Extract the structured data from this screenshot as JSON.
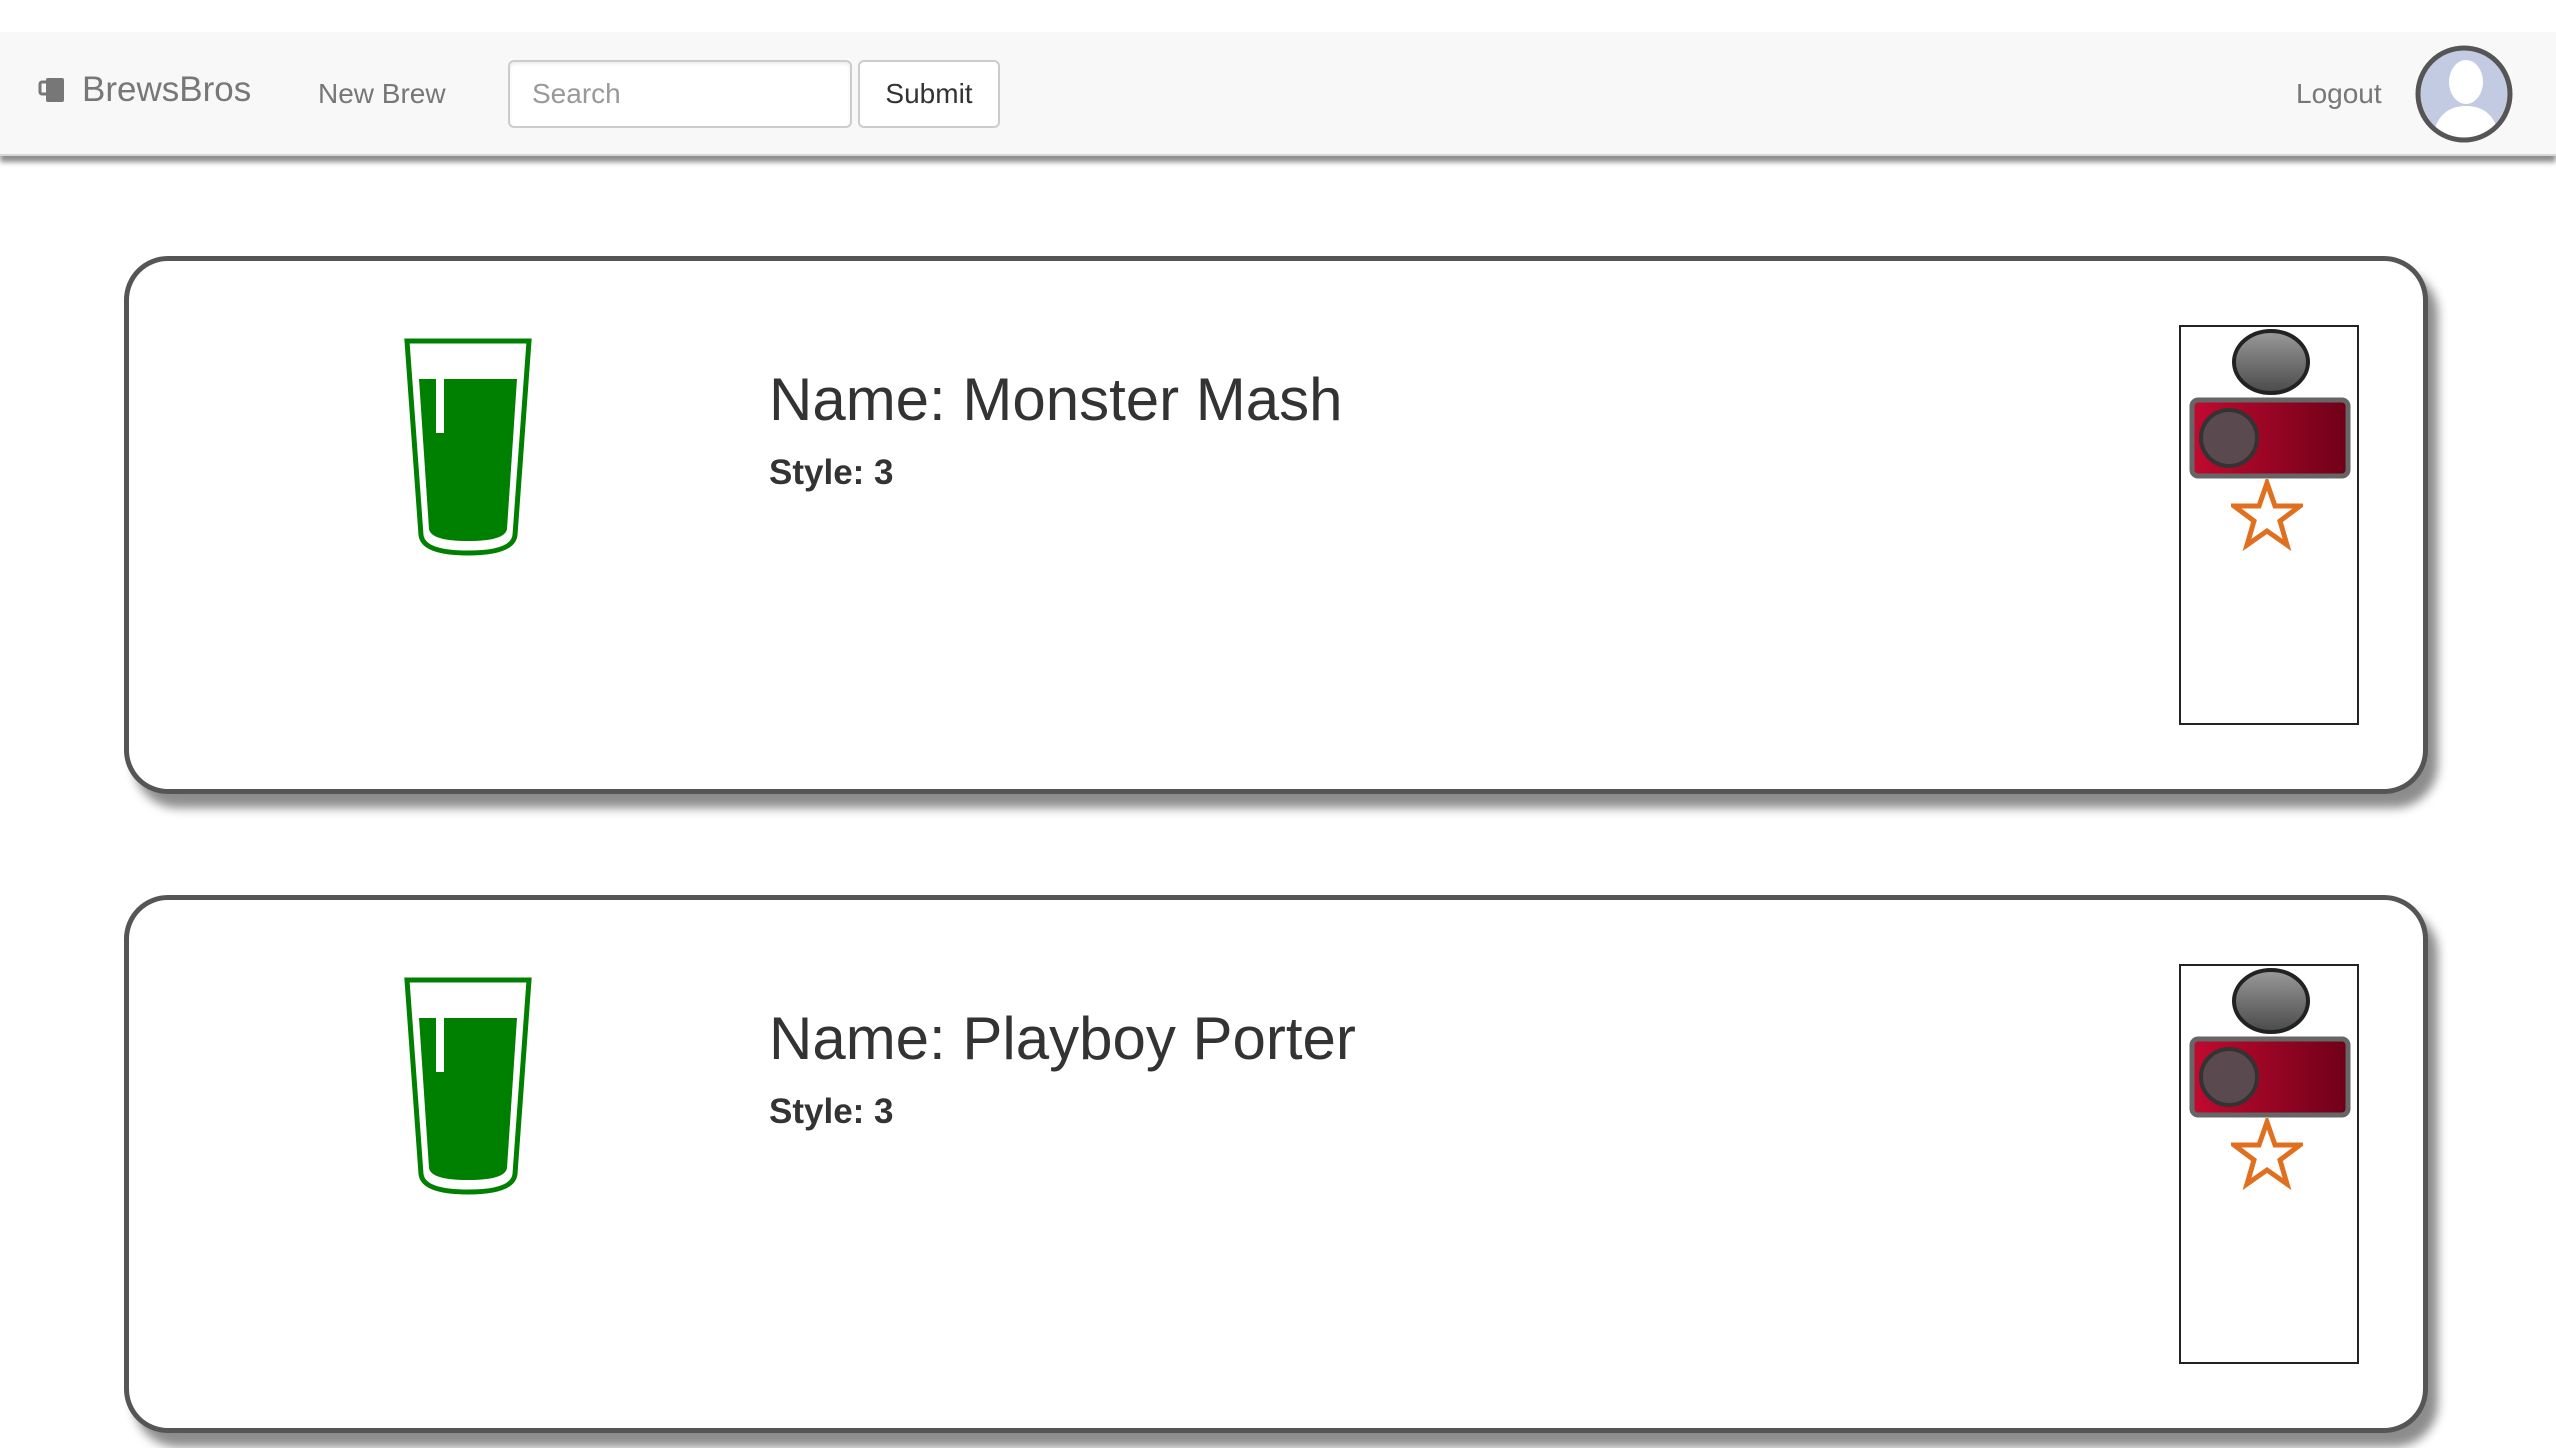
{
  "navbar": {
    "brand": "BrewsBros",
    "brand_icon": "mug-icon",
    "new_brew": "New Brew",
    "search_placeholder": "Search",
    "search_value": "",
    "submit": "Submit",
    "logout": "Logout",
    "avatar_icon": "user-avatar-icon"
  },
  "brews": [
    {
      "name": "Name: Monster Mash",
      "style": "Style: 3",
      "icon": "beer-glass-icon",
      "favorite_icon": "star-icon"
    },
    {
      "name": "Name: Playboy Porter",
      "style": "Style: 3",
      "icon": "beer-glass-icon",
      "favorite_icon": "star-icon"
    }
  ],
  "colors": {
    "beer_green": "#008000",
    "switch_red": "#a8062a",
    "star_orange": "#e07020",
    "card_border": "#555555",
    "navbar_bg": "#f8f8f8"
  }
}
